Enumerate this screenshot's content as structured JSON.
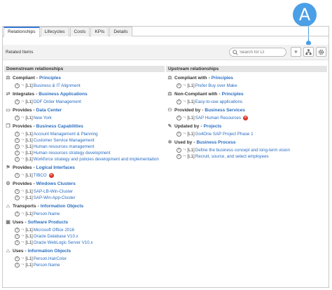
{
  "callout_label": "A",
  "tabs": [
    "Relationships",
    "Lifecycles",
    "Costs",
    "KPIs",
    "Details"
  ],
  "toolbar": {
    "title": "Related Items",
    "search_placeholder": "Search for CI",
    "add_label": "+"
  },
  "downstream": {
    "heading": "Downstream relationships",
    "groups": [
      {
        "icon": "principle-icon",
        "type": "Compliant",
        "target": "Principles",
        "items": [
          {
            "level": "[L1]",
            "name": "Business & IT Alignment"
          }
        ]
      },
      {
        "icon": "integrate-icon",
        "type": "Integrates",
        "target": "Business Applications",
        "items": [
          {
            "level": "[L1]",
            "name": "DDF Order Management"
          }
        ]
      },
      {
        "icon": "datacenter-icon",
        "type": "Provides",
        "target": "Data Center",
        "items": [
          {
            "level": "[L1]",
            "name": "New York"
          }
        ]
      },
      {
        "icon": "capability-icon",
        "type": "Provides",
        "target": "Business Capabilities",
        "items": [
          {
            "level": "[L1]",
            "name": "Account Management & Planning"
          },
          {
            "level": "[L1]",
            "name": "Customer Service Management"
          },
          {
            "level": "[L1]",
            "name": "Human resources management"
          },
          {
            "level": "[L1]",
            "name": "Human resources strategy development"
          },
          {
            "level": "[L1]",
            "name": "Workforce strategy and policies development and implementation"
          }
        ]
      },
      {
        "icon": "interface-icon",
        "type": "Provides",
        "target": "Logical Interfaces",
        "items": [
          {
            "level": "[L1]",
            "name": "TIBCO",
            "warn": true
          }
        ]
      },
      {
        "icon": "cluster-icon",
        "type": "Provides",
        "target": "Windows Clusters",
        "items": [
          {
            "level": "[L1]",
            "name": "SAP-LB-Win-Cluster"
          },
          {
            "level": "[L1]",
            "name": "SAP-Win-App-Cluster"
          }
        ]
      },
      {
        "icon": "info-object-icon",
        "type": "Transports",
        "target": "Information Objects",
        "items": [
          {
            "level": "[L1]",
            "name": "Person.Name"
          }
        ]
      },
      {
        "icon": "software-icon",
        "type": "Uses",
        "target": "Software Products",
        "items": [
          {
            "level": "[L1]",
            "name": "Microsoft Office 2016"
          },
          {
            "level": "[L1]",
            "name": "Oracle Database V10.x"
          },
          {
            "level": "[L1]",
            "name": "Oracle WebLogic Server V10.x"
          }
        ]
      },
      {
        "icon": "info-object-icon",
        "type": "Uses",
        "target": "Information Objects",
        "items": [
          {
            "level": "[L1]",
            "name": "Person.HairColor"
          },
          {
            "level": "[L1]",
            "name": "Person.Name"
          }
        ]
      }
    ]
  },
  "upstream": {
    "heading": "Upstream relationships",
    "groups": [
      {
        "icon": "principle-icon",
        "type": "Compliant with",
        "target": "Principles",
        "items": [
          {
            "level": "[L1]",
            "name": "Prefer Buy over Make"
          }
        ]
      },
      {
        "icon": "principle-icon",
        "type": "Non-Compliant with",
        "target": "Principles",
        "items": [
          {
            "level": "[L1]",
            "name": "Easy-to-use applications"
          }
        ]
      },
      {
        "icon": "service-icon",
        "type": "Provided by",
        "target": "Business Services",
        "items": [
          {
            "level": "[L1]",
            "name": "SAP Human Resources",
            "warn": true
          }
        ]
      },
      {
        "icon": "project-icon",
        "type": "Updated by",
        "target": "Projects",
        "items": [
          {
            "level": "[L1]",
            "name": "Go4One SAP Project Phase 1"
          }
        ]
      },
      {
        "icon": "process-icon",
        "type": "Used by",
        "target": "Business Process",
        "items": [
          {
            "level": "[L1]",
            "name": "Define the business concept and long-term vision"
          },
          {
            "level": "[L1]",
            "name": "Recruit, source, and select employees"
          }
        ]
      }
    ]
  }
}
